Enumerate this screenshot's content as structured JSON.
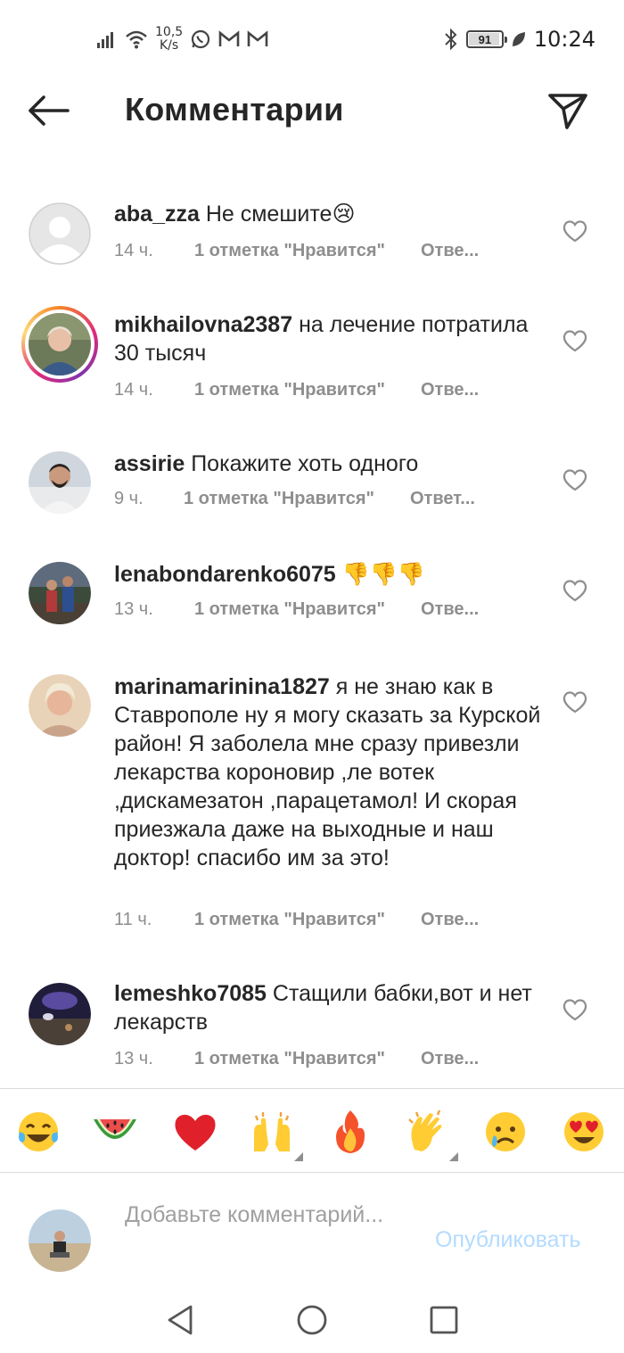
{
  "status_bar": {
    "speed_value": "10,5",
    "speed_unit": "K/s",
    "battery": "91",
    "battery_level": 0.91,
    "time": "10:24"
  },
  "header": {
    "title": "Комментарии",
    "back_icon": "arrow-left-icon",
    "send_icon": "paper-plane-icon"
  },
  "comments": [
    {
      "username": "aba_zza",
      "text": "Не смешите",
      "emoji": "😢",
      "time": "14 ч.",
      "likes": "1 отметка \"Нравится\"",
      "reply": "Отве..."
    },
    {
      "username": "mikhailovna2387",
      "text": "на лечение потратила 30 тысяч",
      "emoji": "",
      "time": "14 ч.",
      "likes": "1 отметка \"Нравится\"",
      "reply": "Отве..."
    },
    {
      "username": "assirie",
      "text": "Покажите хоть одного",
      "emoji": "",
      "time": "9 ч.",
      "likes": "1 отметка \"Нравится\"",
      "reply": "Ответ..."
    },
    {
      "username": "lenabondarenko6075",
      "text": "",
      "emoji": "👎👎👎",
      "time": "13 ч.",
      "likes": "1 отметка \"Нравится\"",
      "reply": "Отве..."
    },
    {
      "username": "marinamarinina1827",
      "text": "я не знаю как в Ставрополе ну я могу сказать за Курской район! Я заболела мне сразу привезли лекарства короновир ,ле вотек ,дискамезатон ,парацетамол! И скорая приезжала даже на выходные и наш доктор! спасибо им за это!",
      "emoji": "",
      "time": "11 ч.",
      "likes": "1 отметка \"Нравится\"",
      "reply": "Отве..."
    },
    {
      "username": "lemeshko7085",
      "text": "Стащили бабки,вот и нет лекарств",
      "emoji": "",
      "time": "13 ч.",
      "likes": "1 отметка \"Нравится\"",
      "reply": "Отве..."
    }
  ],
  "emoji_bar": [
    "😂",
    "🍉",
    "❤️",
    "🙌",
    "🔥",
    "👏",
    "😢",
    "😍"
  ],
  "composer": {
    "placeholder": "Добавьте комментарий...",
    "publish_label": "Опубликовать"
  },
  "colors": {
    "text": "#262626",
    "secondary": "#8e8e8e",
    "publish_disabled": "#b3dbff",
    "divider": "#dbdbdb"
  }
}
